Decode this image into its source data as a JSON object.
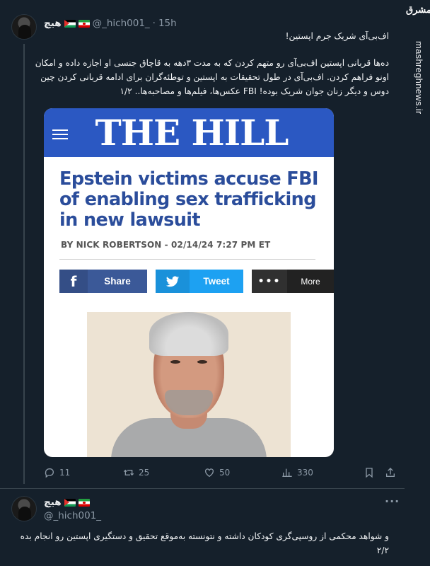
{
  "brand": {
    "logo_text": "مشرق",
    "url": "mashreghnews.ir"
  },
  "tweet1": {
    "author_name": "هیچ",
    "handle": "@_hich001_",
    "separator": "·",
    "time": "15h",
    "text_title": "اف‌بی‌آی شریک جرم اپستین!",
    "text_body": "ده‌ها قربانی اپستین اف‌بی‌آی رو متهم کردن که به مدت ۳دهه به قاچاق جنسی او اجازه داده و امکان اونو فراهم کردن. اف‌بی‌آی در طول تحقیقات به اپستین و توطئه‌گران برای ادامه قربانی کردن چین دوس و دیگر زنان جوان شریک بوده! FBI عکس‌ها، فیلم‌ها و مصاحبه‌ها.. ۱/۲",
    "card": {
      "publication": "THE HILL",
      "headline": "Epstein victims accuse FBI of enabling sex trafficking in new lawsuit",
      "byline": "BY NICK ROBERTSON - 02/14/24 7:27 PM ET",
      "share_facebook": "Share",
      "share_twitter": "Tweet",
      "share_more": "More"
    },
    "actions": {
      "replies": "11",
      "retweets": "25",
      "likes": "50",
      "views": "330"
    }
  },
  "tweet2": {
    "author_name": "هیچ",
    "handle": "@_hich001_",
    "text": "و شواهد محکمی از روسپی‌گری کودکان داشته و نتونسته به‌موقع تحقیق و دستگیری اپستین رو انجام بده ۲/۲"
  },
  "colors": {
    "background": "#15202b",
    "hill_blue": "#2b58c2",
    "headline_blue": "#2b4d9b",
    "facebook": "#3b5998",
    "twitter": "#1da1f2",
    "muted": "#8b98a5"
  },
  "icons": [
    "reply-icon",
    "retweet-icon",
    "like-icon",
    "views-icon",
    "bookmark-icon",
    "share-icon",
    "more-icon"
  ]
}
